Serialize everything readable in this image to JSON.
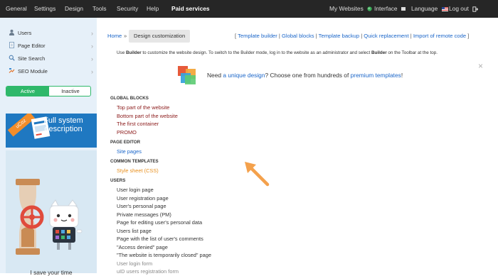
{
  "topnav": {
    "left": [
      "General",
      "Settings",
      "Design",
      "Tools",
      "Security",
      "Help"
    ],
    "paid": "Paid services",
    "my_websites": "My Websites",
    "interface": "Interface",
    "language": "Language",
    "logout": "Log out"
  },
  "sidebar": {
    "items": [
      {
        "label": "Users",
        "icon": "user-icon"
      },
      {
        "label": "Page Editor",
        "icon": "page-icon"
      },
      {
        "label": "Site Search",
        "icon": "search-icon"
      },
      {
        "label": "SEO Module",
        "icon": "seo-icon"
      }
    ],
    "toggle": {
      "active": "Active",
      "inactive": "Inactive"
    },
    "banner1": {
      "tag": "uCoz",
      "headline": "Full system description"
    },
    "banner2": {
      "caption": "I save your time"
    }
  },
  "main": {
    "breadcrumb": {
      "home": "Home",
      "sep": "»",
      "current": "Design customization"
    },
    "quicklinks": [
      "Template builder",
      "Global blocks",
      "Template backup",
      "Quick replacement",
      "Import of remote code"
    ],
    "info": {
      "p1": "Use ",
      "b1": "Builder",
      "p2": " to customize the website design. To switch to the Builder mode, log in to the website as an administrator and select ",
      "b2": "Builder",
      "p3": " on the Toolbar at the top."
    },
    "promo": {
      "pre": "Need ",
      "link1": "a unique design",
      "mid": "? Choose one from hundreds of ",
      "link2": "premium templates",
      "post": "!"
    },
    "close": "×",
    "sections": {
      "global_blocks": {
        "title": "GLOBAL BLOCKS",
        "items": [
          "Top part of the website",
          "Bottom part of the website",
          "The first container",
          "PROMO"
        ]
      },
      "page_editor": {
        "title": "PAGE EDITOR",
        "items": [
          "Site pages"
        ]
      },
      "common_templates": {
        "title": "COMMON TEMPLATES",
        "items": [
          "Style sheet (CSS)"
        ]
      },
      "users": {
        "title": "USERS",
        "items": [
          "User login page",
          "User registration page",
          "User's personal page",
          "Private messages (PM)",
          "Page for editing user's personal data",
          "Users list page",
          "Page with the list of user's comments",
          "\"Access denied\" page",
          "\"The website is temporarily closed\" page",
          "User login form",
          "uID users registration form"
        ]
      }
    }
  },
  "colors": {
    "topbar": "#262626",
    "sidebar": "#e6f0f9",
    "active": "#2fb86a",
    "link": "#1b66c9",
    "maroon": "#8b1a1a",
    "orange": "#e8901f",
    "arrow": "#f4a14c"
  }
}
